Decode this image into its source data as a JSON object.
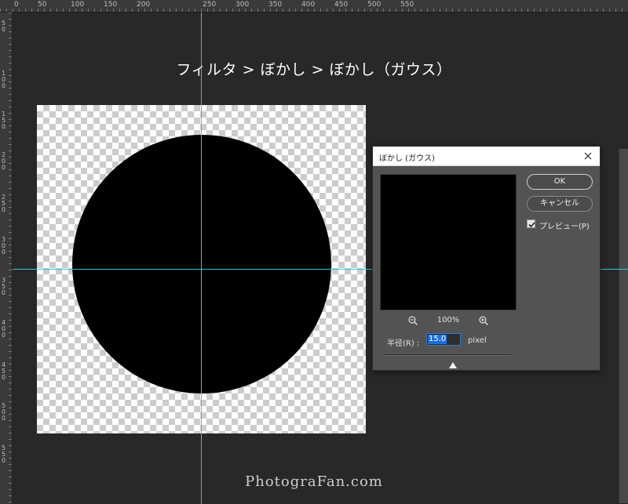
{
  "caption": "フィルタ > ぼかし > ぼかし（ガウス）",
  "watermark": "PhotograFan.com",
  "ruler": {
    "top_labels": [
      "0",
      "50",
      "100",
      "150",
      "200",
      "250",
      "300",
      "350",
      "400",
      "450",
      "500",
      "550"
    ],
    "left_labels": [
      "50",
      "100",
      "150",
      "200",
      "250",
      "300",
      "350",
      "400",
      "450",
      "500",
      "550"
    ]
  },
  "dialog": {
    "title": "ぼかし (ガウス)",
    "ok_label": "OK",
    "cancel_label": "キャンセル",
    "preview_label": "プレビュー(P)",
    "preview_checked": true,
    "zoom_label": "100%",
    "radius_label": "半径(R) :",
    "radius_value": "15.0",
    "radius_unit": "pixel",
    "slider_value": 15.0
  },
  "icons": {
    "close": "close-icon",
    "zoom_out": "zoom-out-icon",
    "zoom_in": "zoom-in-icon",
    "check": "checkmark-icon",
    "slider_thumb": "slider-thumb-icon"
  },
  "colors": {
    "guide": "#35c6d8",
    "workspace": "#282828",
    "dialog_bg": "#535353",
    "input_highlight": "#1e6fd9"
  }
}
